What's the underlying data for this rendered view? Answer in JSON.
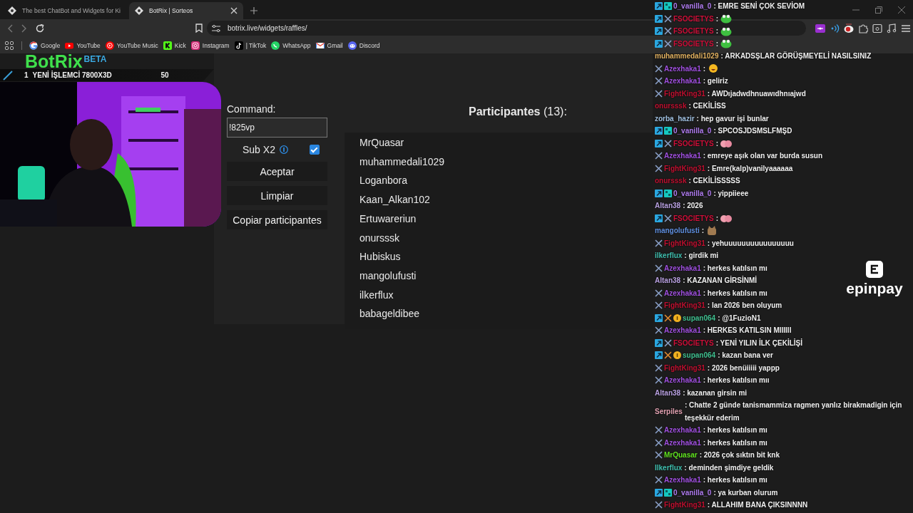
{
  "browser": {
    "tabs": [
      {
        "label": "The best ChatBot and Widgets for Ki",
        "selected": false
      },
      {
        "label": "BotRix | Sorteos",
        "selected": true
      }
    ],
    "address": "botrix.live/widgets/raffles/",
    "bookmarks": [
      {
        "label": "Google",
        "kind": "google"
      },
      {
        "label": "YouTube",
        "kind": "youtube"
      },
      {
        "label": "YouTube Music",
        "kind": "ytmusic"
      },
      {
        "label": "Kick",
        "kind": "kick"
      },
      {
        "label": "Instagram",
        "kind": "instagram"
      },
      {
        "label": "| TikTok",
        "kind": "tiktok"
      },
      {
        "label": "WhatsApp",
        "kind": "whatsapp"
      },
      {
        "label": "Gmail",
        "kind": "gmail"
      },
      {
        "label": "Discord",
        "kind": "discord"
      }
    ]
  },
  "logo": {
    "text": "BotRix",
    "badge": "BETA"
  },
  "goal_bar": {
    "rank": "1",
    "item": "YENİ İŞLEMCİ 7800X3D",
    "value": "50"
  },
  "form": {
    "label": "Command:",
    "command": "!825vp",
    "sub_label": "Sub X2",
    "sub_checked": true,
    "buttons": [
      "Aceptar",
      "Limpiar",
      "Copiar participantes"
    ]
  },
  "participants": {
    "title": "**Participantes** (13):",
    "names": [
      "MrQuasar",
      "muhammedali1029",
      "Loganbora",
      "Kaan_Alkan102",
      "Ertuwareriun",
      "onursssk",
      "Hubiskus",
      "mangolufusti",
      "ilkerflux",
      "babageldibee"
    ]
  },
  "chat": [
    {
      "badges": [
        {
          "kind": "sub"
        },
        {
          "kind": "grid"
        }
      ],
      "user": "0_vanilla_0",
      "color": "#b07cf0",
      "text": ": EMRE SENİ ÇOK SEVİOM"
    },
    {
      "badges": [
        {
          "kind": "sub"
        },
        {
          "kind": "sword"
        }
      ],
      "user": "FSOCIETYS",
      "color": "#d0103a",
      "text": ":",
      "emote": {
        "kind": "frog"
      }
    },
    {
      "badges": [
        {
          "kind": "sub"
        },
        {
          "kind": "sword"
        }
      ],
      "user": "FSOCIETYS",
      "color": "#d0103a",
      "text": ":",
      "emote": {
        "kind": "frog"
      }
    },
    {
      "badges": [
        {
          "kind": "sub"
        },
        {
          "kind": "sword"
        }
      ],
      "user": "FSOCIETYS",
      "color": "#d0103a",
      "text": ":",
      "emote": {
        "kind": "frog"
      }
    },
    {
      "user": "muhammedali1029",
      "color": "#e0b060",
      "text": ": ARKADSŞLAR GÖRÜŞMEYELİ NASILSINIZ"
    },
    {
      "badges": [
        {
          "kind": "sword"
        }
      ],
      "user": "Azexhaka1",
      "color": "#a050e0",
      "text": ":",
      "emote": {
        "kind": "smile"
      }
    },
    {
      "badges": [
        {
          "kind": "sword"
        }
      ],
      "user": "Azexhaka1",
      "color": "#a050e0",
      "text": ": geliriz"
    },
    {
      "badges": [
        {
          "kind": "sword"
        }
      ],
      "user": "FightKing31",
      "color": "#c01030",
      "text": ": AWDıjadwdhnuawıdhnıajwd"
    },
    {
      "user": "onursssk",
      "color": "#c01030",
      "text": ": CEKİLİSS"
    },
    {
      "user": "zorba_hazir",
      "color": "#a0c0e0",
      "text": ": hep gavur işi bunlar"
    },
    {
      "badges": [
        {
          "kind": "sub"
        },
        {
          "kind": "grid"
        }
      ],
      "user": "0_vanilla_0",
      "color": "#b07cf0",
      "text": ": SPCOSJDSMSLFMŞD"
    },
    {
      "badges": [
        {
          "kind": "sub"
        },
        {
          "kind": "sword"
        }
      ],
      "user": "FSOCIETYS",
      "color": "#d0103a",
      "text": ":",
      "emote": {
        "kind": "hands"
      }
    },
    {
      "badges": [
        {
          "kind": "sword"
        }
      ],
      "user": "Azexhaka1",
      "color": "#a050e0",
      "text": ": emreye aşık olan var burda susun"
    },
    {
      "badges": [
        {
          "kind": "sword"
        }
      ],
      "user": "FightKing31",
      "color": "#c01030",
      "text": ": Emre(kalp)vanilyaaaaaa"
    },
    {
      "user": "onursssk",
      "color": "#c01030",
      "text": ": CEKİLİSSSSS"
    },
    {
      "badges": [
        {
          "kind": "sub"
        },
        {
          "kind": "grid"
        }
      ],
      "user": "0_vanilla_0",
      "color": "#b07cf0",
      "text": ": yippiieee"
    },
    {
      "user": "Altan38",
      "color": "#b8a0e0",
      "text": ": 2026"
    },
    {
      "badges": [
        {
          "kind": "sub"
        },
        {
          "kind": "sword"
        }
      ],
      "user": "FSOCIETYS",
      "color": "#d0103a",
      "text": ":",
      "emote": {
        "kind": "hands"
      }
    },
    {
      "user": "mangolufusti",
      "color": "#6090e0",
      "text": ":",
      "emote": {
        "kind": "cat"
      }
    },
    {
      "badges": [
        {
          "kind": "sword"
        }
      ],
      "user": "FightKing31",
      "color": "#c01030",
      "text": ": yehuuuuuuuuuuuuuuuu"
    },
    {
      "user": "ilkerflux",
      "color": "#40c0b0",
      "text": ": girdik mi"
    },
    {
      "badges": [
        {
          "kind": "sword"
        }
      ],
      "user": "Azexhaka1",
      "color": "#a050e0",
      "text": ": herkes katılsın mı"
    },
    {
      "user": "Altan38",
      "color": "#b8a0e0",
      "text": ": KAZANAN GİRSİNMİ"
    },
    {
      "badges": [
        {
          "kind": "sword"
        }
      ],
      "user": "Azexhaka1",
      "color": "#a050e0",
      "text": ": herkes katılsın mı"
    },
    {
      "badges": [
        {
          "kind": "sword"
        }
      ],
      "user": "FightKing31",
      "color": "#c01030",
      "text": ": lan 2026 ben oluyum"
    },
    {
      "badges": [
        {
          "kind": "sub"
        },
        {
          "kind": "sword-gold"
        },
        {
          "kind": "coin"
        }
      ],
      "user": "supan064",
      "color": "#40c090",
      "text": ": @1FuzioN1"
    },
    {
      "badges": [
        {
          "kind": "sword"
        }
      ],
      "user": "Azexhaka1",
      "color": "#a050e0",
      "text": ": HERKES KATILSIN MIIIIII"
    },
    {
      "badges": [
        {
          "kind": "sub"
        },
        {
          "kind": "sword"
        }
      ],
      "user": "FSOCIETYS",
      "color": "#d0103a",
      "text": ": YENİ YILIN İLK ÇEKİLİŞİ"
    },
    {
      "badges": [
        {
          "kind": "sub"
        },
        {
          "kind": "sword-gold"
        },
        {
          "kind": "coin"
        }
      ],
      "user": "supan064",
      "color": "#40c090",
      "text": ": kazan bana ver"
    },
    {
      "badges": [
        {
          "kind": "sword"
        }
      ],
      "user": "FightKing31",
      "color": "#c01030",
      "text": ": 2026 benüiiiii yappp"
    },
    {
      "badges": [
        {
          "kind": "sword"
        }
      ],
      "user": "Azexhaka1",
      "color": "#a050e0",
      "text": ": herkes katılsın mıı"
    },
    {
      "user": "Altan38",
      "color": "#b8a0e0",
      "text": ": kazanan girsin mi"
    },
    {
      "user": "Serpiles",
      "color": "#e0a0b0",
      "text": ": Chatte 2 günde tanismammiza ragmen yanlız birakmadigin için teşekkür ederim"
    },
    {
      "badges": [
        {
          "kind": "sword"
        }
      ],
      "user": "Azexhaka1",
      "color": "#a050e0",
      "text": ": herkes katılsın mı"
    },
    {
      "badges": [
        {
          "kind": "sword"
        }
      ],
      "user": "Azexhaka1",
      "color": "#a050e0",
      "text": ": herkes katılsın mı"
    },
    {
      "badges": [
        {
          "kind": "sword"
        }
      ],
      "user": "MrQuasar",
      "color": "#60e020",
      "text": ": 2026 çok sıktın bit knk"
    },
    {
      "user": "Ilkerflux",
      "color": "#40c0b0",
      "text": ": deminden şimdiye geldik"
    },
    {
      "badges": [
        {
          "kind": "sword"
        }
      ],
      "user": "Azexhaka1",
      "color": "#a050e0",
      "text": ": herkes katılsın mı"
    },
    {
      "badges": [
        {
          "kind": "sub"
        },
        {
          "kind": "grid"
        }
      ],
      "user": "0_vanilla_0",
      "color": "#b07cf0",
      "text": ": ya kurban olurum"
    },
    {
      "badges": [
        {
          "kind": "sword"
        }
      ],
      "user": "FightKing31",
      "color": "#c01030",
      "text": ": ALLAHIM BANA ÇIKSINNNN"
    }
  ],
  "sponsor": {
    "text": "epinpay"
  }
}
